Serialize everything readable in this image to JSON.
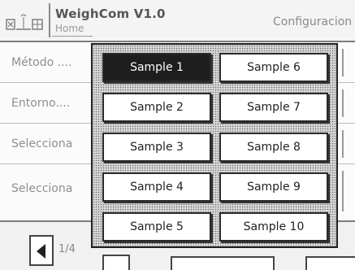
{
  "header": {
    "title": "WeighCom V1.0",
    "subtitle": "Home",
    "section": "Configuracion",
    "icon": "balance-icon"
  },
  "rows": [
    {
      "label": "Método ...."
    },
    {
      "label": "Entorno...."
    },
    {
      "label": "Selecciona"
    },
    {
      "label": "Selecciona"
    }
  ],
  "footer": {
    "page": "1/4"
  },
  "popup": {
    "selected": "Sample 1",
    "samples": [
      "Sample 1",
      "Sample 2",
      "Sample 3",
      "Sample 4",
      "Sample 5",
      "Sample 6",
      "Sample 7",
      "Sample 8",
      "Sample 9",
      "Sample 10"
    ]
  },
  "colors": {
    "selected_bg": "#1e1e1e",
    "popup_border": "#202020"
  }
}
